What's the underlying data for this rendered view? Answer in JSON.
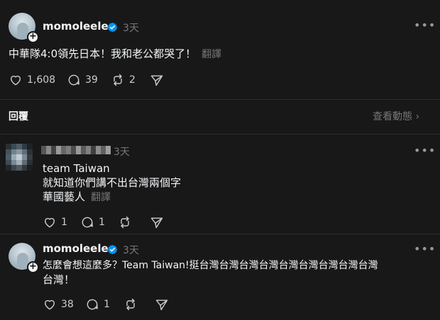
{
  "post": {
    "username": "momoleelee",
    "time": "3天",
    "text": "中華隊4:0領先日本！我和老公都哭了！",
    "translate_label": "翻譯",
    "likes": "1,608",
    "comments": "39",
    "reposts": "2"
  },
  "replies_header": {
    "title": "回覆",
    "view_activity": "查看動態 ›"
  },
  "reply1": {
    "time": "3天",
    "line1": "team Taiwan",
    "line2": "就知道你們講不出台灣兩個字",
    "line3": "華國藝人",
    "translate_label": "翻譯",
    "likes": "1",
    "comments": "1"
  },
  "reply2": {
    "username": "momoleelee",
    "time": "3天",
    "line1": "怎麼會想這麼多？Team Taiwan!挺台灣台灣台灣台灣台灣台灣台灣台灣台灣",
    "line2": "台灣！",
    "likes": "38",
    "comments": "1"
  },
  "colors": {
    "background": "#181818",
    "text": "#f3f5f7",
    "muted": "#777777",
    "verified": "#0095f6"
  }
}
